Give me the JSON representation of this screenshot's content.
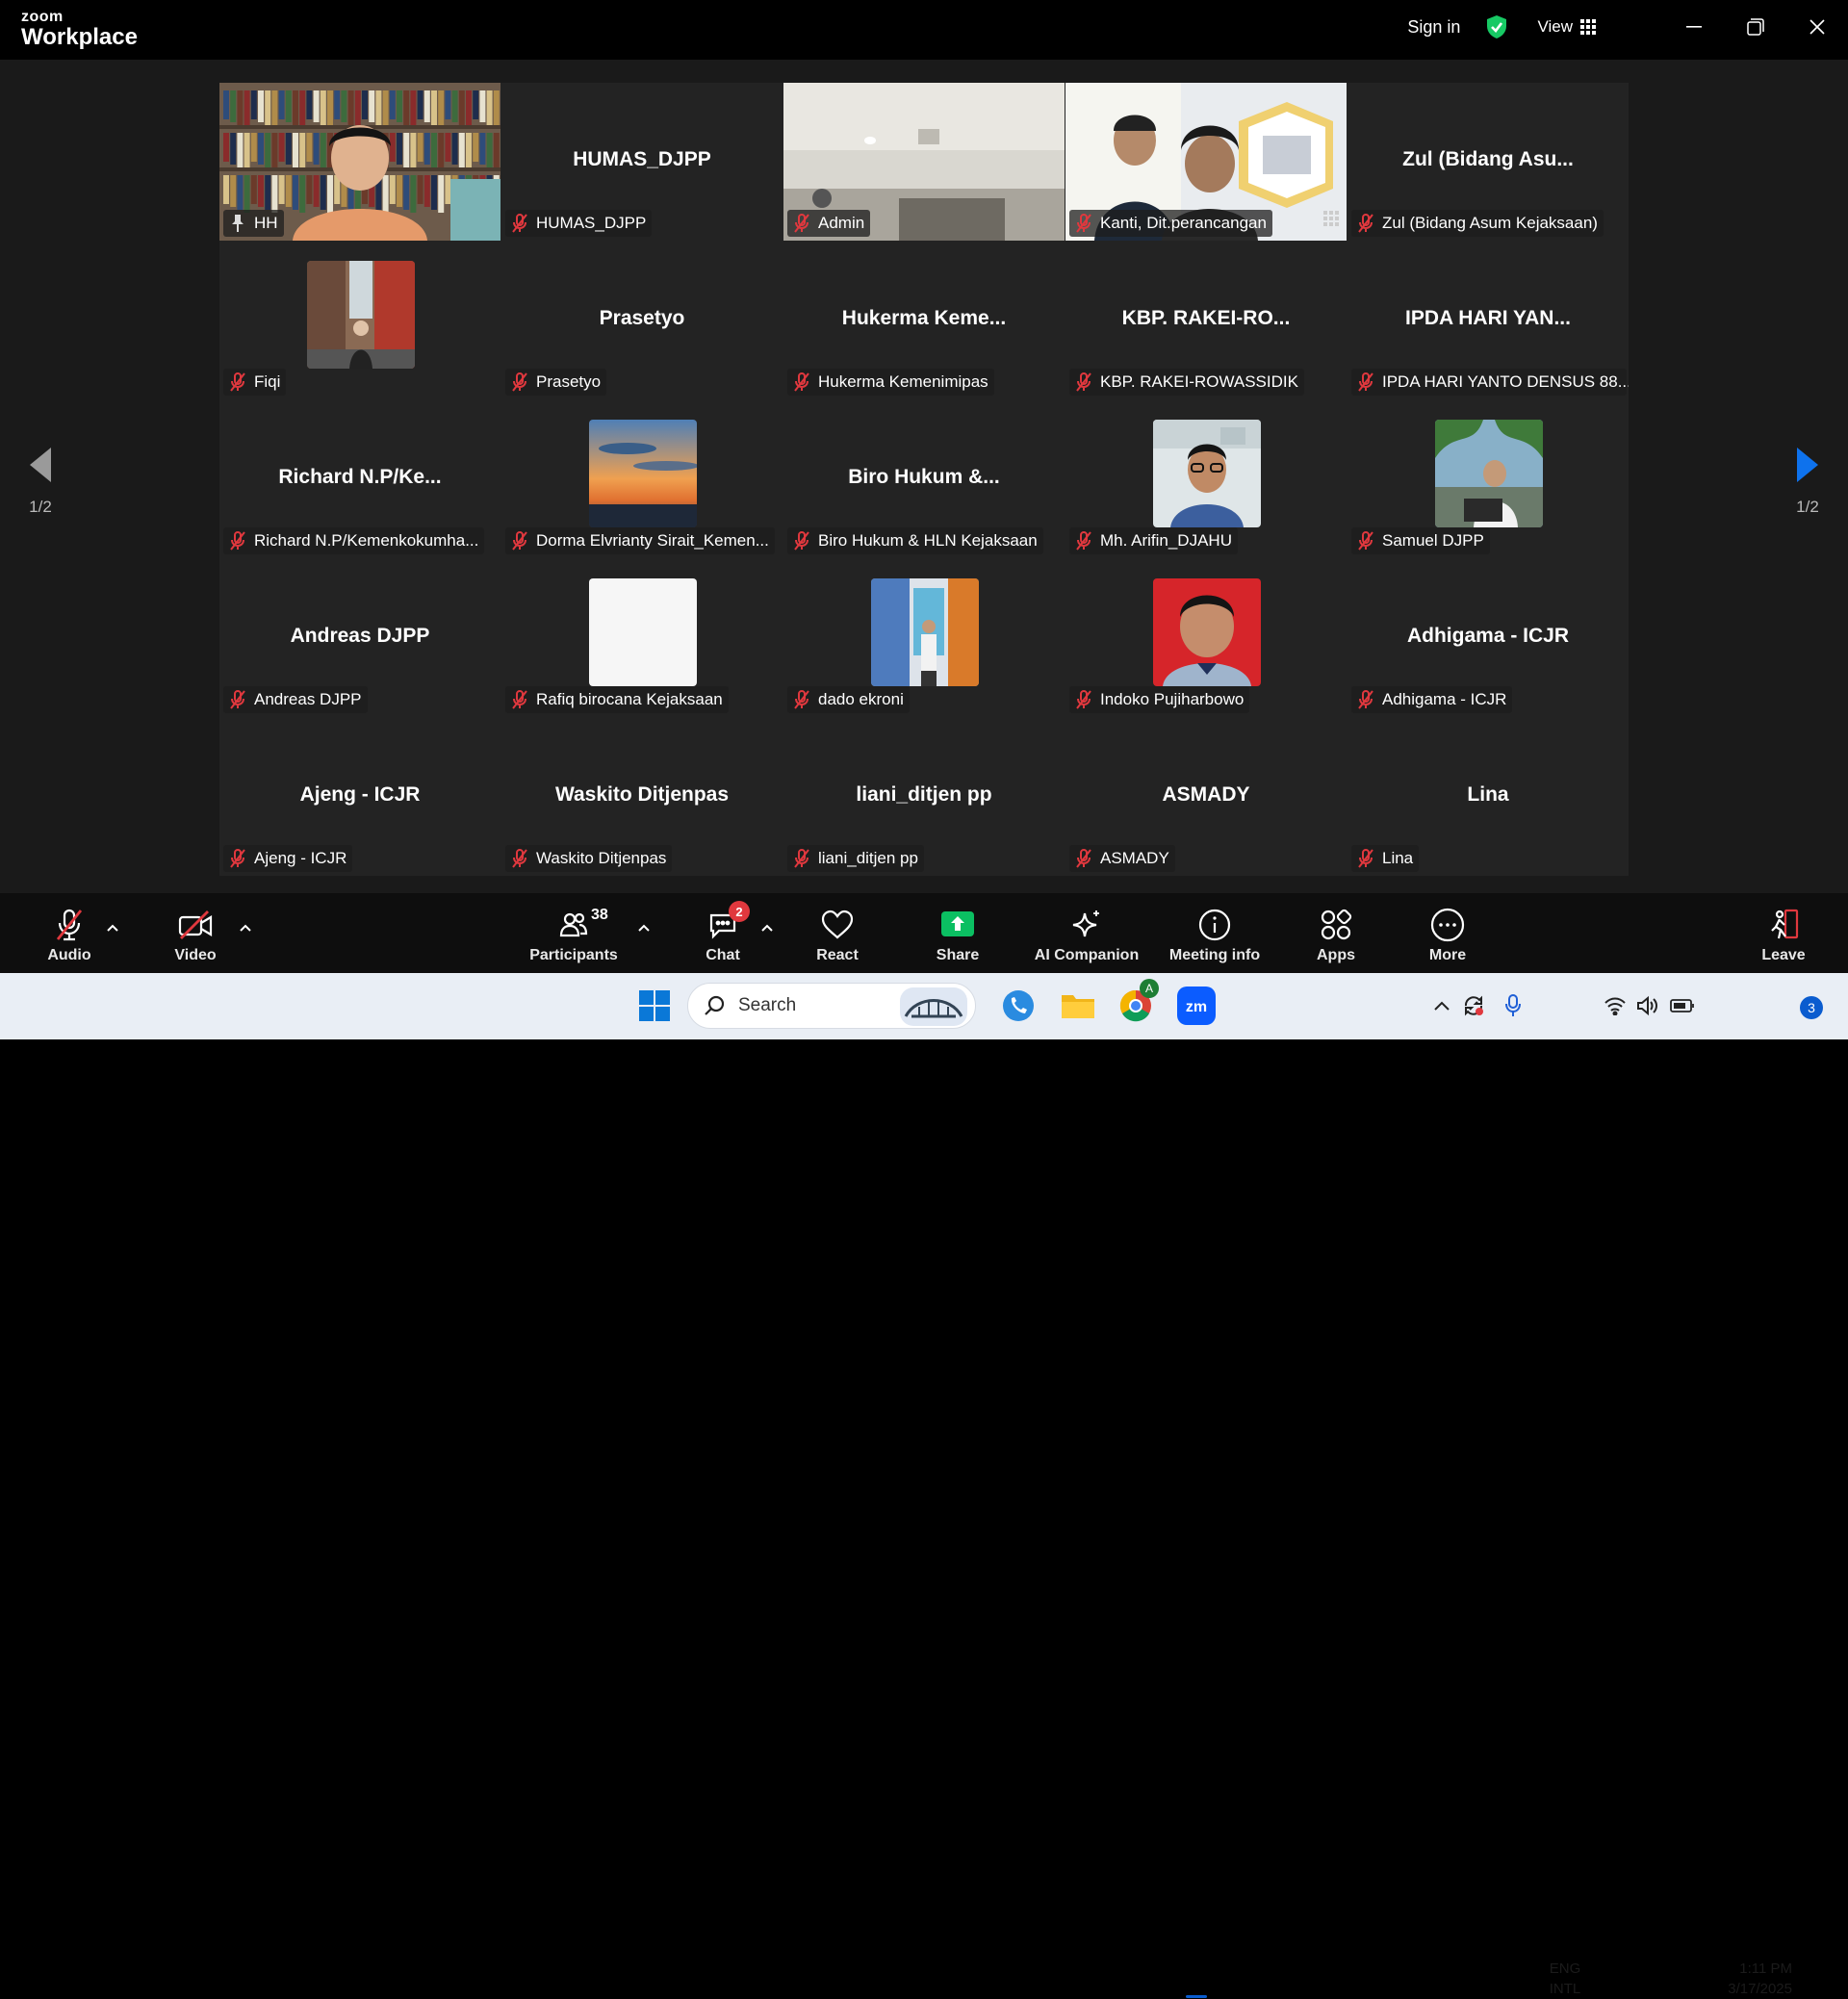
{
  "app": {
    "brand_top": "zoom",
    "brand_bottom": "Workplace",
    "sign_in": "Sign in",
    "view_label": "View"
  },
  "gallery": {
    "page_indicator_left": "1/2",
    "page_indicator_right": "1/2",
    "tiles": [
      {
        "label": "HH",
        "big": "",
        "kind": "video-bookshelf",
        "active": true
      },
      {
        "label": "HUMAS_DJPP",
        "big": "HUMAS_DJPP",
        "kind": "name"
      },
      {
        "label": "Admin",
        "big": "",
        "kind": "video-room"
      },
      {
        "label": "Kanti, Dit.perancangan",
        "big": "",
        "kind": "video-people"
      },
      {
        "label": "Zul (Bidang Asum Kejaksaan)",
        "big": "Zul (Bidang Asu...",
        "kind": "name"
      },
      {
        "label": "Fiqi",
        "big": "",
        "kind": "pic-street"
      },
      {
        "label": "Prasetyo",
        "big": "Prasetyo",
        "kind": "name"
      },
      {
        "label": "Hukerma Kemenimipas",
        "big": "Hukerma  Keme...",
        "kind": "name"
      },
      {
        "label": "KBP. RAKEI-ROWASSIDIK",
        "big": "KBP. RAKEI-RO...",
        "kind": "name"
      },
      {
        "label": "IPDA HARI YANTO DENSUS 88...",
        "big": "IPDA HARI YAN...",
        "kind": "name"
      },
      {
        "label": "Richard N.P/Kemenkokumha...",
        "big": "Richard  N.P/Ke...",
        "kind": "name"
      },
      {
        "label": "Dorma Elvrianty Sirait_Kemen...",
        "big": "",
        "kind": "pic-sunset"
      },
      {
        "label": "Biro Hukum & HLN Kejaksaan",
        "big": "Biro  Hukum  &...",
        "kind": "name"
      },
      {
        "label": "Mh. Arifin_DJAHU",
        "big": "",
        "kind": "pic-man-glasses"
      },
      {
        "label": "Samuel DJPP",
        "big": "",
        "kind": "pic-laptop"
      },
      {
        "label": "Andreas DJPP",
        "big": "Andreas DJPP",
        "kind": "name"
      },
      {
        "label": "Rafiq birocana Kejaksaan",
        "big": "",
        "kind": "pic-white"
      },
      {
        "label": "dado ekroni",
        "big": "",
        "kind": "pic-banner"
      },
      {
        "label": "Indoko Pujiharbowo",
        "big": "",
        "kind": "pic-red"
      },
      {
        "label": "Adhigama - ICJR",
        "big": "Adhigama - ICJR",
        "kind": "name"
      },
      {
        "label": "Ajeng - ICJR",
        "big": "Ajeng - ICJR",
        "kind": "name"
      },
      {
        "label": "Waskito Ditjenpas",
        "big": "Waskito Ditjenpas",
        "kind": "name"
      },
      {
        "label": "liani_ditjen pp",
        "big": "liani_ditjen pp",
        "kind": "name"
      },
      {
        "label": "ASMADY",
        "big": "ASMADY",
        "kind": "name"
      },
      {
        "label": "Lina",
        "big": "Lina",
        "kind": "name"
      }
    ]
  },
  "toolbar": {
    "audio": "Audio",
    "video": "Video",
    "participants": "Participants",
    "participants_count": "38",
    "chat": "Chat",
    "chat_badge": "2",
    "react": "React",
    "share": "Share",
    "ai_companion": "AI Companion",
    "meeting_info": "Meeting info",
    "apps": "Apps",
    "more": "More",
    "leave": "Leave"
  },
  "taskbar": {
    "search_placeholder": "Search",
    "lang_top": "ENG",
    "lang_bottom": "INTL",
    "time": "1:11 PM",
    "date": "3/17/2025",
    "notification_count": "3",
    "chrome_badge": "A"
  },
  "colors": {
    "active_speaker": "#2be28a",
    "share_green": "#0bbf62",
    "muted_red": "#e0383e",
    "nav_arrow_blue": "#0e72ed"
  }
}
